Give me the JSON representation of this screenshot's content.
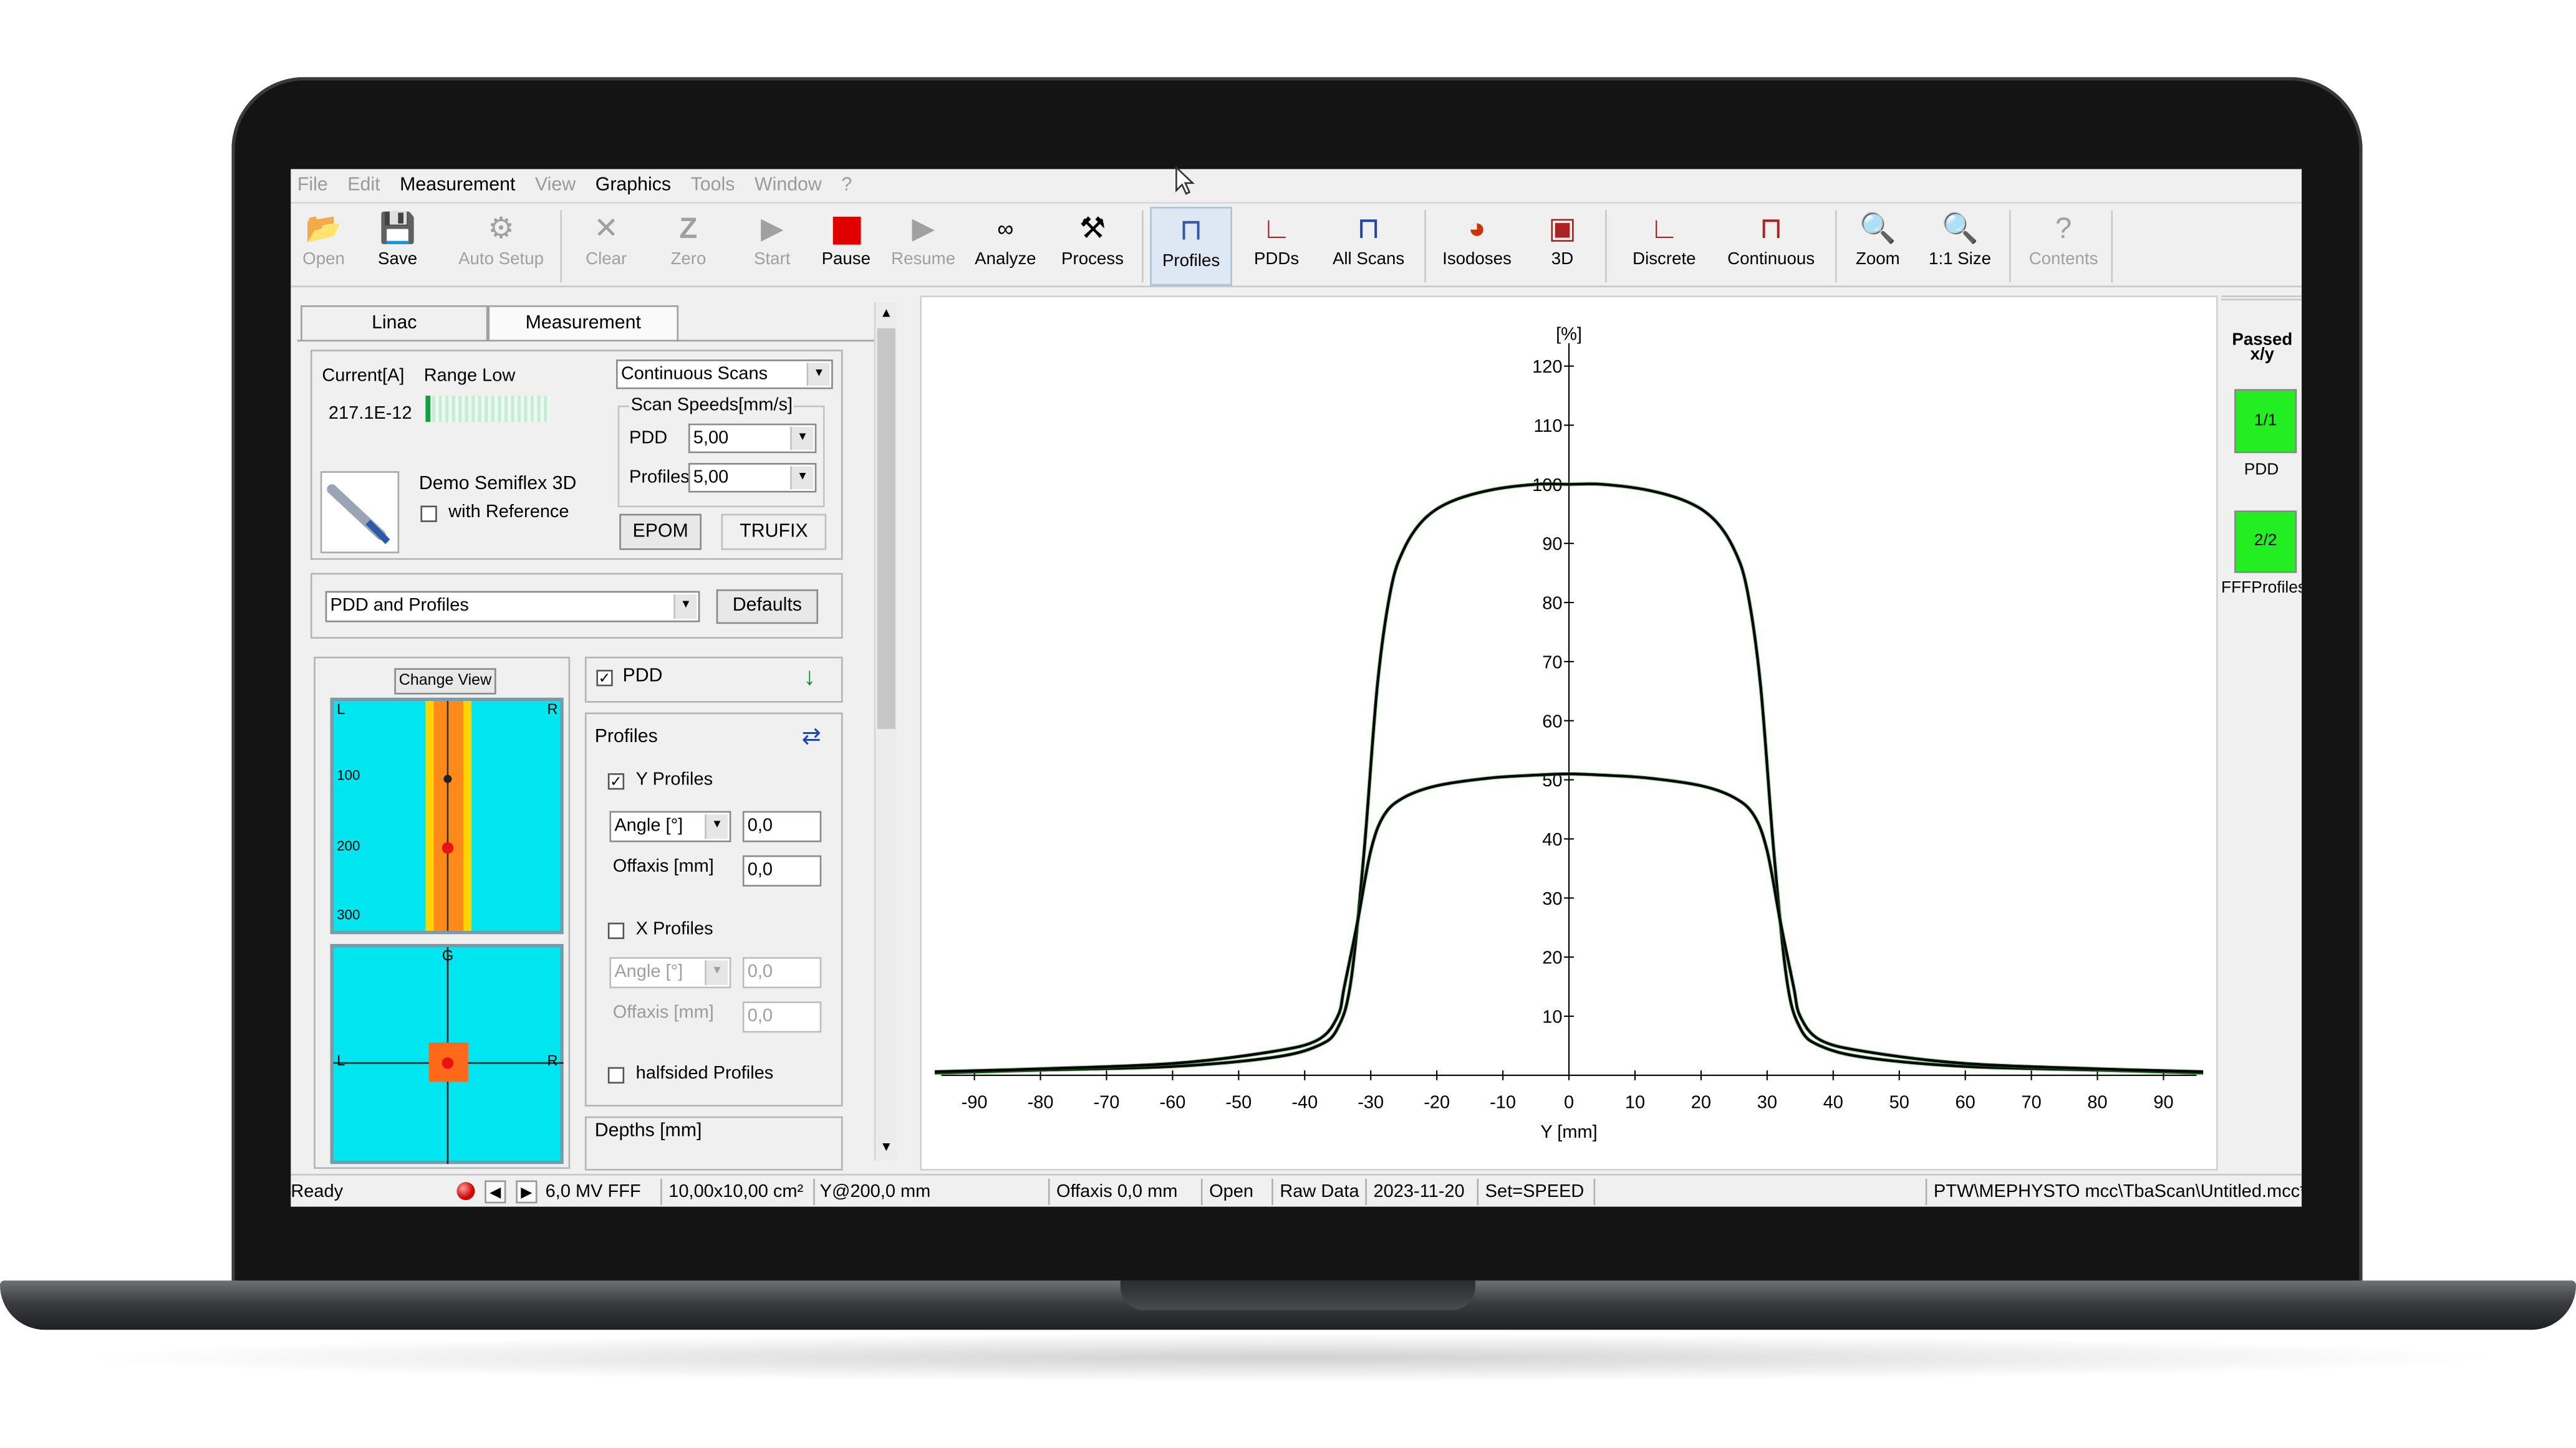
{
  "menu": [
    {
      "label": "File",
      "enabled": false
    },
    {
      "label": "Edit",
      "enabled": false
    },
    {
      "label": "Measurement",
      "enabled": true
    },
    {
      "label": "View",
      "enabled": false
    },
    {
      "label": "Graphics",
      "enabled": true
    },
    {
      "label": "Tools",
      "enabled": false
    },
    {
      "label": "Window",
      "enabled": false
    },
    {
      "label": "?",
      "enabled": false
    }
  ],
  "toolbar": {
    "open": "Open",
    "save": "Save",
    "auto_setup": "Auto Setup",
    "clear": "Clear",
    "zero": "Zero",
    "start": "Start",
    "pause": "Pause",
    "resume": "Resume",
    "analyze": "Analyze",
    "process": "Process",
    "profiles": "Profiles",
    "pdds": "PDDs",
    "all_scans": "All Scans",
    "isodoses": "Isodoses",
    "three_d": "3D",
    "discrete": "Discrete",
    "continuous": "Continuous",
    "zoom": "Zoom",
    "one_to_one": "1:1 Size",
    "contents": "Contents"
  },
  "tabs": {
    "linac": "Linac",
    "measurement": "Measurement"
  },
  "detector": {
    "current_label": "Current[A]",
    "range_label": "Range Low",
    "current_value": "217.1E-12",
    "name": "Demo Semiflex 3D",
    "with_reference": "with Reference"
  },
  "scan": {
    "mode": "Continuous Scans",
    "speeds_label": "Scan Speeds[mm/s]",
    "pdd_label": "PDD",
    "pdd_value": "5,00",
    "profiles_label": "Profiles",
    "profiles_value": "5,00",
    "epom": "EPOM",
    "trufix": "TRUFIX"
  },
  "task": {
    "value": "PDD and Profiles",
    "defaults": "Defaults"
  },
  "view": {
    "change_view": "Change View",
    "l": "L",
    "r": "R",
    "g": "G",
    "ticks": [
      "100",
      "200",
      "300"
    ]
  },
  "options": {
    "pdd": "PDD",
    "profiles": "Profiles",
    "y_profiles": "Y Profiles",
    "x_profiles": "X Profiles",
    "angle_label": "Angle [°]",
    "angle_y": "0,0",
    "offaxis_label": "Offaxis [mm]",
    "offaxis_y": "0,0",
    "angle_x": "0,0",
    "offaxis_x": "0,0",
    "halfsided": "halfsided Profiles",
    "depths": "Depths [mm]"
  },
  "results": {
    "header": "Passed x/y",
    "pdd_badge": "1/1",
    "pdd_label": "PDD",
    "fff_badge": "2/2",
    "fff_label": "FFFProfiles",
    "pass_color": "#22ee22"
  },
  "status": {
    "ready": "Ready",
    "energy": "6,0 MV FFF",
    "field": "10,00x10,00 cm²",
    "pos": "Y@200,0 mm",
    "offaxis": "Offaxis 0,0 mm",
    "open": "Open",
    "raw": "Raw Data",
    "date": "2023-11-20",
    "set": "Set=SPEED",
    "path": "PTW\\MEPHYSTO mcc\\TbaScan\\Untitled.mcc*"
  },
  "chart_data": {
    "type": "line",
    "xlabel": "Y [mm]",
    "ylabel": "[%]",
    "xlim": [
      -95,
      95
    ],
    "ylim": [
      0,
      120
    ],
    "xticks": [
      -90,
      -80,
      -70,
      -60,
      -50,
      -40,
      -30,
      -20,
      -10,
      0,
      10,
      20,
      30,
      40,
      50,
      60,
      70,
      80,
      90
    ],
    "yticks": [
      10,
      20,
      30,
      40,
      50,
      60,
      70,
      80,
      90,
      100,
      110,
      120
    ],
    "series": [
      {
        "x": [
          -96,
          -80,
          -60,
          -45,
          -38,
          -35,
          -33,
          -31,
          -29,
          -27,
          -25,
          -22,
          -18,
          -12,
          -5,
          0,
          5,
          12,
          18,
          22,
          25,
          27,
          29,
          31,
          33,
          35,
          38,
          45,
          60,
          80,
          96
        ],
        "y": [
          0.4,
          0.9,
          1.5,
          3,
          5,
          8,
          16,
          38,
          66,
          82,
          89,
          94,
          97,
          99,
          100,
          100,
          100,
          99,
          97,
          94,
          89,
          82,
          66,
          38,
          16,
          8,
          5,
          3,
          1.5,
          0.9,
          0.4
        ]
      },
      {
        "x": [
          -96,
          -80,
          -60,
          -45,
          -38,
          -35,
          -34,
          -32,
          -30,
          -28,
          -25,
          -20,
          -12,
          -5,
          0,
          5,
          12,
          20,
          25,
          28,
          30,
          32,
          34,
          35,
          38,
          45,
          60,
          80,
          96
        ],
        "y": [
          0.6,
          1.1,
          2,
          4,
          6,
          10,
          15,
          26,
          38,
          44,
          47,
          49,
          50.3,
          50.8,
          51,
          50.8,
          50.3,
          49,
          47,
          44,
          38,
          26,
          15,
          10,
          6,
          4,
          2,
          1.1,
          0.6
        ]
      }
    ]
  }
}
